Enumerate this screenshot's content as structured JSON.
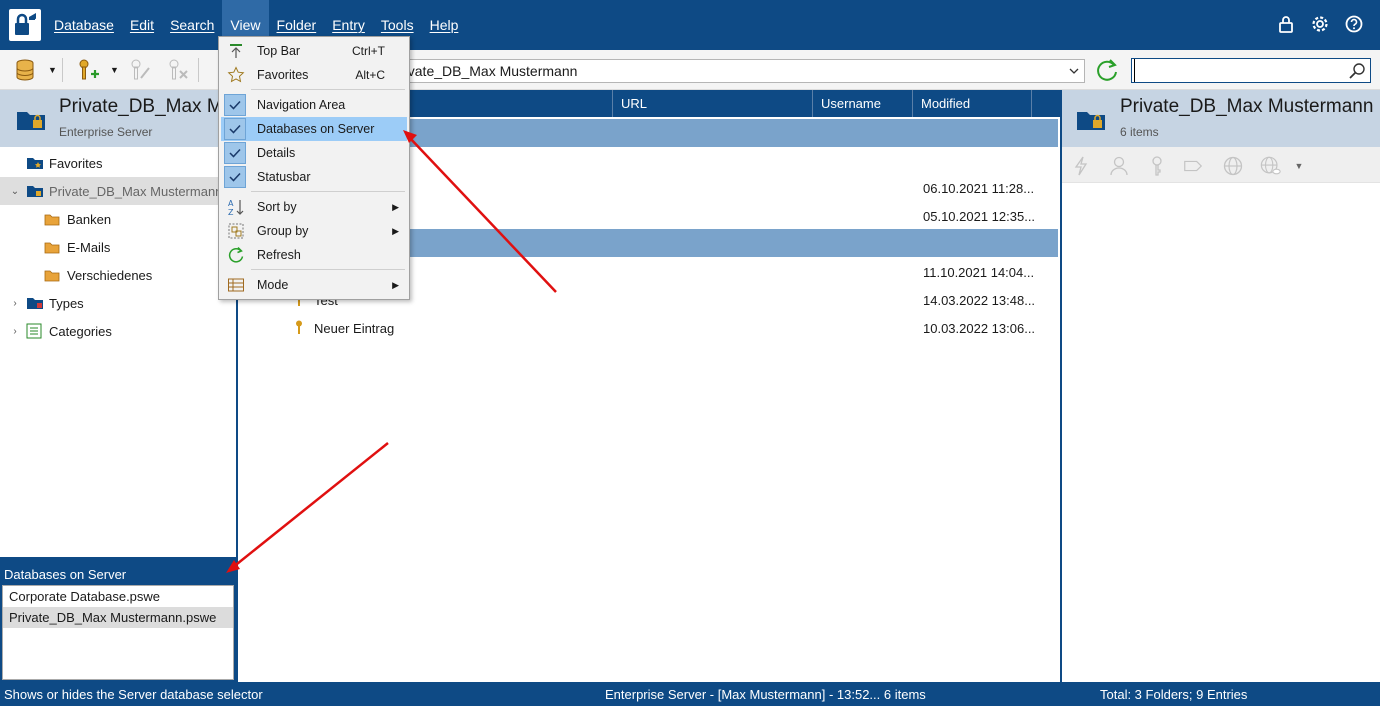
{
  "menubar": {
    "items": [
      "Database",
      "Edit",
      "Search",
      "View",
      "Folder",
      "Entry",
      "Tools",
      "Help"
    ]
  },
  "toolbar": {
    "path_value": "rivate_DB_Max Mustermann",
    "search_value": ""
  },
  "left_panel": {
    "title": "Private_DB_Max M...",
    "subtitle": "Enterprise Server",
    "tree": [
      {
        "label": "Favorites",
        "icon": "favorites-folder-icon",
        "level": 0,
        "expander": ""
      },
      {
        "label": "Private_DB_Max Mustermann",
        "icon": "database-folder-icon",
        "level": 0,
        "expander": "expanded",
        "selected": true
      },
      {
        "label": "Banken",
        "icon": "folder-icon",
        "level": 1,
        "expander": ""
      },
      {
        "label": "E-Mails",
        "icon": "folder-icon",
        "level": 1,
        "expander": ""
      },
      {
        "label": "Verschiedenes",
        "icon": "folder-icon",
        "level": 1,
        "expander": ""
      },
      {
        "label": "Types",
        "icon": "types-folder-icon",
        "level": 0,
        "expander": "collapsed"
      },
      {
        "label": "Categories",
        "icon": "categories-icon",
        "level": 0,
        "expander": "collapsed"
      }
    ]
  },
  "db_panel": {
    "title": "Databases on Server",
    "items": [
      {
        "label": "Corporate Database.pswe",
        "selected": false
      },
      {
        "label": "Private_DB_Max Mustermann.pswe",
        "selected": true
      }
    ]
  },
  "main_list": {
    "columns": [
      "URL",
      "Username",
      "Modified"
    ],
    "rows": [
      {
        "title": "",
        "modified": "06.10.2021 11:28..."
      },
      {
        "title": "",
        "modified": "05.10.2021 12:35..."
      },
      {
        "title": "",
        "modified": "11.10.2021 14:04..."
      },
      {
        "title": "Test",
        "modified": "14.03.2022 13:48..."
      },
      {
        "title": "Neuer Eintrag",
        "modified": "10.03.2022 13:06..."
      }
    ]
  },
  "right_panel": {
    "title": "Private_DB_Max Mustermann",
    "subtitle": "6 items"
  },
  "view_menu": {
    "items": [
      {
        "label": "Top Bar",
        "shortcut": "Ctrl+T",
        "icon": "top-bar-icon"
      },
      {
        "label": "Favorites",
        "shortcut": "Alt+C",
        "icon": "star-icon"
      },
      {
        "label": "Navigation Area",
        "checked": true
      },
      {
        "label": "Databases on Server",
        "checked": true,
        "highlighted": true
      },
      {
        "label": "Details",
        "checked": true
      },
      {
        "label": "Statusbar",
        "checked": true
      },
      {
        "label": "Sort by",
        "submenu": true,
        "icon": "sort-icon"
      },
      {
        "label": "Group by",
        "submenu": true,
        "icon": "group-icon"
      },
      {
        "label": "Refresh",
        "icon": "refresh-icon"
      },
      {
        "label": "Mode",
        "submenu": true,
        "icon": "mode-icon"
      }
    ]
  },
  "statusbar": {
    "left": "Shows or hides the Server database selector",
    "middle": "Enterprise Server - [Max Mustermann] - 13:52...   6 items",
    "right": "Total: 3 Folders; 9 Entries"
  },
  "colors": {
    "brand_blue": "#0e4a85",
    "group_row": "#7aa3cb",
    "menu_highlight": "#9cccf7",
    "annotation_red": "#e01010"
  }
}
